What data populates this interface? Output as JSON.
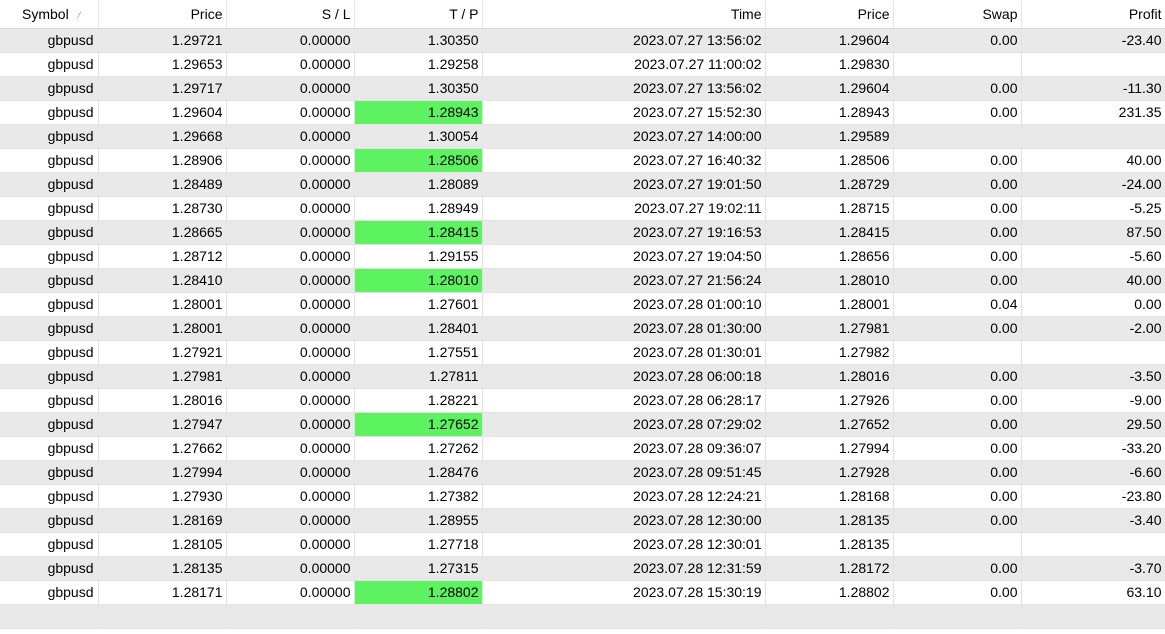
{
  "columns": [
    "Symbol",
    "Price",
    "S / L",
    "T / P",
    "Time",
    "Price",
    "Swap",
    "Profit"
  ],
  "colors": {
    "stripe": "#e9e9e9",
    "tp_highlight": "#5df25f",
    "grid": "#e2e2e2"
  },
  "sort_icon": "sort-indicator-icon",
  "rows": [
    {
      "symbol": "gbpusd",
      "price": "1.29721",
      "sl": "0.00000",
      "tp": "1.30350",
      "time": "2023.07.27 13:56:02",
      "close_price": "1.29604",
      "swap": "0.00",
      "profit": "-23.40",
      "tp_highlight": false
    },
    {
      "symbol": "gbpusd",
      "price": "1.29653",
      "sl": "0.00000",
      "tp": "1.29258",
      "time": "2023.07.27 11:00:02",
      "close_price": "1.29830",
      "swap": "",
      "profit": "",
      "tp_highlight": false
    },
    {
      "symbol": "gbpusd",
      "price": "1.29717",
      "sl": "0.00000",
      "tp": "1.30350",
      "time": "2023.07.27 13:56:02",
      "close_price": "1.29604",
      "swap": "0.00",
      "profit": "-11.30",
      "tp_highlight": false
    },
    {
      "symbol": "gbpusd",
      "price": "1.29604",
      "sl": "0.00000",
      "tp": "1.28943",
      "time": "2023.07.27 15:52:30",
      "close_price": "1.28943",
      "swap": "0.00",
      "profit": "231.35",
      "tp_highlight": true
    },
    {
      "symbol": "gbpusd",
      "price": "1.29668",
      "sl": "0.00000",
      "tp": "1.30054",
      "time": "2023.07.27 14:00:00",
      "close_price": "1.29589",
      "swap": "",
      "profit": "",
      "tp_highlight": false
    },
    {
      "symbol": "gbpusd",
      "price": "1.28906",
      "sl": "0.00000",
      "tp": "1.28506",
      "time": "2023.07.27 16:40:32",
      "close_price": "1.28506",
      "swap": "0.00",
      "profit": "40.00",
      "tp_highlight": true
    },
    {
      "symbol": "gbpusd",
      "price": "1.28489",
      "sl": "0.00000",
      "tp": "1.28089",
      "time": "2023.07.27 19:01:50",
      "close_price": "1.28729",
      "swap": "0.00",
      "profit": "-24.00",
      "tp_highlight": false
    },
    {
      "symbol": "gbpusd",
      "price": "1.28730",
      "sl": "0.00000",
      "tp": "1.28949",
      "time": "2023.07.27 19:02:11",
      "close_price": "1.28715",
      "swap": "0.00",
      "profit": "-5.25",
      "tp_highlight": false
    },
    {
      "symbol": "gbpusd",
      "price": "1.28665",
      "sl": "0.00000",
      "tp": "1.28415",
      "time": "2023.07.27 19:16:53",
      "close_price": "1.28415",
      "swap": "0.00",
      "profit": "87.50",
      "tp_highlight": true
    },
    {
      "symbol": "gbpusd",
      "price": "1.28712",
      "sl": "0.00000",
      "tp": "1.29155",
      "time": "2023.07.27 19:04:50",
      "close_price": "1.28656",
      "swap": "0.00",
      "profit": "-5.60",
      "tp_highlight": false
    },
    {
      "symbol": "gbpusd",
      "price": "1.28410",
      "sl": "0.00000",
      "tp": "1.28010",
      "time": "2023.07.27 21:56:24",
      "close_price": "1.28010",
      "swap": "0.00",
      "profit": "40.00",
      "tp_highlight": true
    },
    {
      "symbol": "gbpusd",
      "price": "1.28001",
      "sl": "0.00000",
      "tp": "1.27601",
      "time": "2023.07.28 01:00:10",
      "close_price": "1.28001",
      "swap": "0.04",
      "profit": "0.00",
      "tp_highlight": false
    },
    {
      "symbol": "gbpusd",
      "price": "1.28001",
      "sl": "0.00000",
      "tp": "1.28401",
      "time": "2023.07.28 01:30:00",
      "close_price": "1.27981",
      "swap": "0.00",
      "profit": "-2.00",
      "tp_highlight": false
    },
    {
      "symbol": "gbpusd",
      "price": "1.27921",
      "sl": "0.00000",
      "tp": "1.27551",
      "time": "2023.07.28 01:30:01",
      "close_price": "1.27982",
      "swap": "",
      "profit": "",
      "tp_highlight": false
    },
    {
      "symbol": "gbpusd",
      "price": "1.27981",
      "sl": "0.00000",
      "tp": "1.27811",
      "time": "2023.07.28 06:00:18",
      "close_price": "1.28016",
      "swap": "0.00",
      "profit": "-3.50",
      "tp_highlight": false
    },
    {
      "symbol": "gbpusd",
      "price": "1.28016",
      "sl": "0.00000",
      "tp": "1.28221",
      "time": "2023.07.28 06:28:17",
      "close_price": "1.27926",
      "swap": "0.00",
      "profit": "-9.00",
      "tp_highlight": false
    },
    {
      "symbol": "gbpusd",
      "price": "1.27947",
      "sl": "0.00000",
      "tp": "1.27652",
      "time": "2023.07.28 07:29:02",
      "close_price": "1.27652",
      "swap": "0.00",
      "profit": "29.50",
      "tp_highlight": true
    },
    {
      "symbol": "gbpusd",
      "price": "1.27662",
      "sl": "0.00000",
      "tp": "1.27262",
      "time": "2023.07.28 09:36:07",
      "close_price": "1.27994",
      "swap": "0.00",
      "profit": "-33.20",
      "tp_highlight": false
    },
    {
      "symbol": "gbpusd",
      "price": "1.27994",
      "sl": "0.00000",
      "tp": "1.28476",
      "time": "2023.07.28 09:51:45",
      "close_price": "1.27928",
      "swap": "0.00",
      "profit": "-6.60",
      "tp_highlight": false
    },
    {
      "symbol": "gbpusd",
      "price": "1.27930",
      "sl": "0.00000",
      "tp": "1.27382",
      "time": "2023.07.28 12:24:21",
      "close_price": "1.28168",
      "swap": "0.00",
      "profit": "-23.80",
      "tp_highlight": false
    },
    {
      "symbol": "gbpusd",
      "price": "1.28169",
      "sl": "0.00000",
      "tp": "1.28955",
      "time": "2023.07.28 12:30:00",
      "close_price": "1.28135",
      "swap": "0.00",
      "profit": "-3.40",
      "tp_highlight": false
    },
    {
      "symbol": "gbpusd",
      "price": "1.28105",
      "sl": "0.00000",
      "tp": "1.27718",
      "time": "2023.07.28 12:30:01",
      "close_price": "1.28135",
      "swap": "",
      "profit": "",
      "tp_highlight": false
    },
    {
      "symbol": "gbpusd",
      "price": "1.28135",
      "sl": "0.00000",
      "tp": "1.27315",
      "time": "2023.07.28 12:31:59",
      "close_price": "1.28172",
      "swap": "0.00",
      "profit": "-3.70",
      "tp_highlight": false
    },
    {
      "symbol": "gbpusd",
      "price": "1.28171",
      "sl": "0.00000",
      "tp": "1.28802",
      "time": "2023.07.28 15:30:19",
      "close_price": "1.28802",
      "swap": "0.00",
      "profit": "63.10",
      "tp_highlight": true
    },
    {
      "symbol": "",
      "price": "",
      "sl": "",
      "tp": "",
      "time": "",
      "close_price": "",
      "swap": "",
      "profit": "",
      "tp_highlight": false
    }
  ]
}
